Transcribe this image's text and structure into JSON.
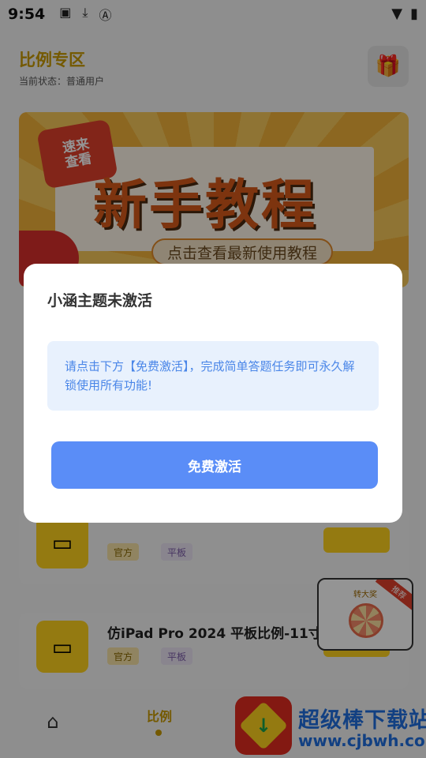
{
  "status_bar": {
    "time": "9:54",
    "left_icons": [
      "image-icon",
      "download-icon",
      "font-icon"
    ],
    "right_icons": [
      "wifi-icon",
      "battery-charging-icon"
    ]
  },
  "header": {
    "title": "比例专区",
    "subtitle": "当前状态：普通用户",
    "gift_icon": "gift-icon"
  },
  "banner": {
    "badge_line1": "速来",
    "badge_line2": "查看",
    "title": "新手教程",
    "subtitle": "点击查看最新使用教程"
  },
  "list": [
    {
      "title": "",
      "tag_official": "官方",
      "tag_tablet": "平板"
    },
    {
      "title": "仿iPad Pro 2024 平板比例-11寸",
      "tag_official": "官方",
      "tag_tablet": "平板"
    }
  ],
  "float_widget": {
    "label": "转大奖",
    "ribbon": "推荐"
  },
  "tabbar": {
    "home_icon": "home-icon",
    "ratio_label": "比例"
  },
  "watermark": {
    "title": "超级棒下载站",
    "url": "www.cjbwh.com"
  },
  "modal": {
    "title": "小涵主题未激活",
    "message": "请点击下方【免费激活】，完成简单答题任务即可永久解锁使用所有功能!",
    "button_label": "免费激活"
  },
  "colors": {
    "accent_yellow": "#ffd21e",
    "title_gold": "#c89a00",
    "button_blue": "#5a8df7",
    "note_bg": "#e8f1fd",
    "note_text": "#4a86e8"
  }
}
